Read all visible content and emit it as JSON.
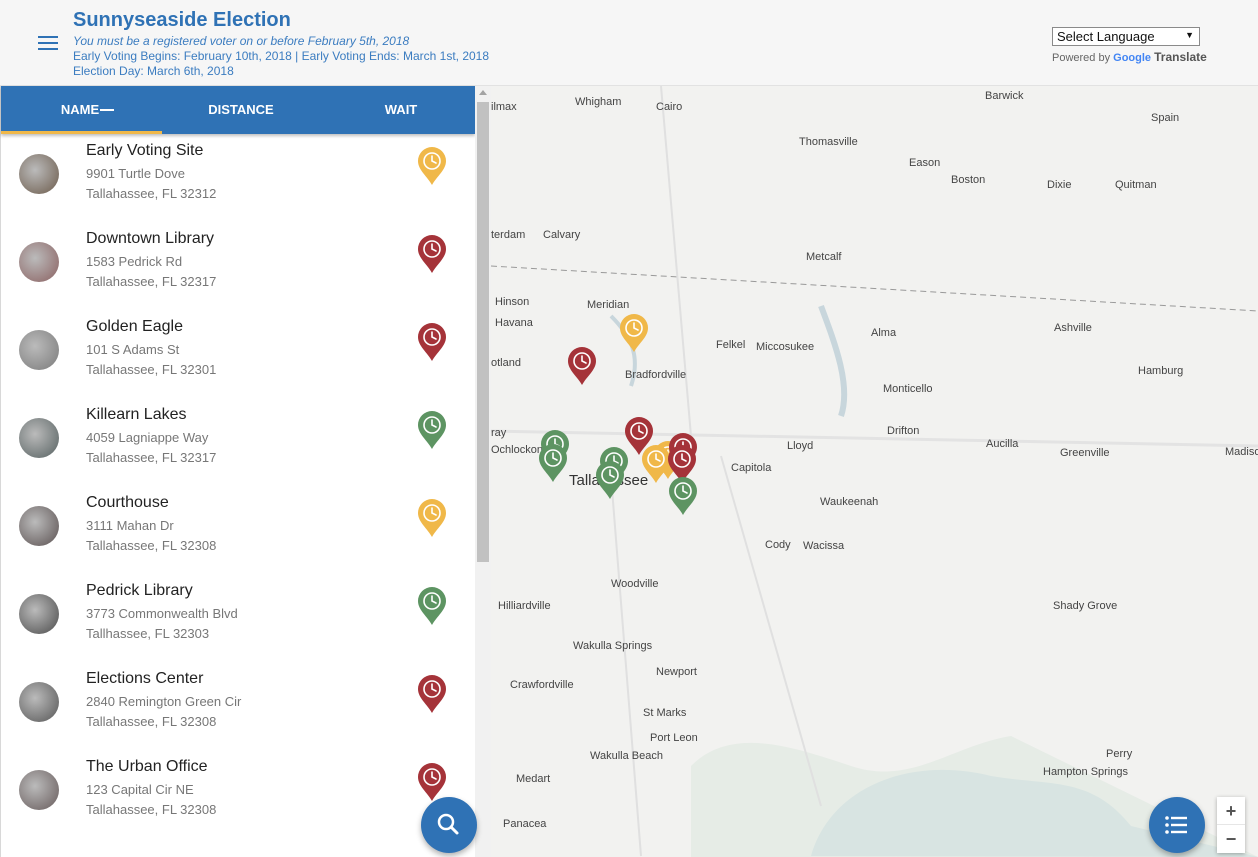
{
  "header": {
    "title": "Sunnyseaside Election",
    "subtitle": "You must be a registered voter on or before February 5th, 2018",
    "line1": "Early Voting Begins: February 10th, 2018 | Early Voting Ends: March 1st, 2018",
    "line2": "Election Day: March 6th, 2018",
    "language_select": "Select Language",
    "powered_by": "Powered by",
    "google": "Google",
    "translate": "Translate"
  },
  "tabs": [
    {
      "label": "NAME"
    },
    {
      "label": "DISTANCE"
    },
    {
      "label": "WAIT"
    }
  ],
  "colors": {
    "red": "#a53339",
    "green": "#5d9462",
    "yellow": "#f0b849",
    "primary": "#2f72b5"
  },
  "locations": [
    {
      "name": "Early Voting Site",
      "address": "9901 Turtle Dove",
      "city": "Tallahassee, FL 32312",
      "wait": "yellow"
    },
    {
      "name": "Downtown Library",
      "address": "1583 Pedrick Rd",
      "city": "Tallahassee, FL 32317",
      "wait": "red"
    },
    {
      "name": "Golden Eagle",
      "address": "101 S Adams St",
      "city": "Tallahassee, FL 32301",
      "wait": "red"
    },
    {
      "name": "Killearn Lakes",
      "address": "4059 Lagniappe Way",
      "city": "Tallahassee, FL 32317",
      "wait": "green"
    },
    {
      "name": "Courthouse",
      "address": "3111 Mahan Dr",
      "city": "Tallahassee, FL 32308",
      "wait": "yellow"
    },
    {
      "name": "Pedrick Library",
      "address": "3773 Commonwealth Blvd",
      "city": "Tallhassee, FL 32303",
      "wait": "green"
    },
    {
      "name": "Elections Center",
      "address": "2840 Remington Green Cir",
      "city": "Tallahassee, FL 32308",
      "wait": "red"
    },
    {
      "name": "The Urban Office",
      "address": "123 Capital Cir NE",
      "city": "Tallahassee, FL 32308",
      "wait": "red"
    }
  ],
  "map": {
    "labels": [
      "Whigham",
      "Cairo",
      "Barwick",
      "Spain",
      "Thomasville",
      "Eason",
      "Boston",
      "Dixie",
      "Quitman",
      "Calvary",
      "Metcalf",
      "Hinson",
      "Havana",
      "Meridian",
      "Ashville",
      "Alma",
      "Felkel",
      "Miccosukee",
      "Bradfordville",
      "Hamburg",
      "Monticello",
      "Drifton",
      "Lloyd",
      "Aucilla",
      "Greenville",
      "Capitola",
      "Tallahassee",
      "Waukeenah",
      "Cody",
      "Wacissa",
      "Woodville",
      "Hilliardville",
      "Shady Grove",
      "Wakulla Springs",
      "Newport",
      "Crawfordville",
      "St Marks",
      "Port Leon",
      "Wakulla Beach",
      "Perry",
      "Hampton Springs",
      "Medart",
      "Panacea",
      "ilmax",
      "terdam",
      "otland",
      "ray",
      "Ochlockon",
      "Madiso"
    ],
    "zoom_in": "+",
    "zoom_out": "−"
  }
}
